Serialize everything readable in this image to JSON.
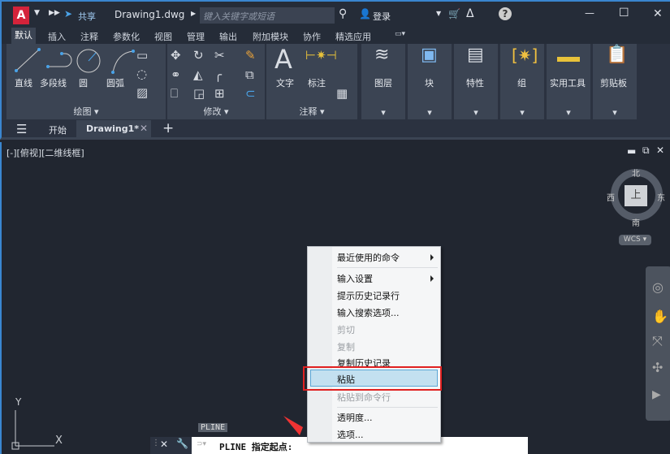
{
  "titlebar": {
    "logo": "A",
    "share": "共享",
    "filename": "Drawing1.dwg",
    "search_placeholder": "键入关键字或短语",
    "login": "登录"
  },
  "menu_tabs": [
    "默认",
    "插入",
    "注释",
    "参数化",
    "视图",
    "管理",
    "输出",
    "附加模块",
    "协作",
    "精选应用"
  ],
  "ribbon": {
    "draw": {
      "buttons": [
        "直线",
        "多段线",
        "圆",
        "圆弧"
      ],
      "label": "绘图"
    },
    "modify": {
      "label": "修改"
    },
    "annotate": {
      "buttons": [
        "文字",
        "标注"
      ],
      "label": "注释"
    },
    "panels": [
      "图层",
      "块",
      "特性",
      "组",
      "实用工具",
      "剪贴板"
    ]
  },
  "file_tabs": {
    "start": "开始",
    "drawing": "Drawing1*"
  },
  "viewport": {
    "label": "[-][俯视][二维线框]",
    "viewcube": {
      "top": "上",
      "north": "北",
      "south": "南",
      "east": "东",
      "west": "西",
      "wcs": "WCS"
    },
    "ucs_x": "X",
    "ucs_y": "Y"
  },
  "context_menu": {
    "items": [
      {
        "label": "最近使用的命令",
        "submenu": true,
        "disabled": false
      },
      {
        "label": "输入设置",
        "submenu": true,
        "disabled": false
      },
      {
        "label": "提示历史记录行",
        "disabled": false
      },
      {
        "label": "输入搜索选项...",
        "disabled": false
      },
      {
        "label": "剪切",
        "disabled": true
      },
      {
        "label": "复制",
        "disabled": true
      },
      {
        "label": "复制历史记录",
        "disabled": false
      },
      {
        "label": "粘贴",
        "disabled": false,
        "highlighted": true
      },
      {
        "label": "粘贴到命令行",
        "disabled": true
      },
      {
        "label": "透明度...",
        "disabled": false
      },
      {
        "label": "选项...",
        "disabled": false
      }
    ]
  },
  "command": {
    "tooltip": "PLINE",
    "prompt": "PLINE 指定起点:"
  },
  "colors": {
    "accent": "#3a86d0",
    "highlight_box": "#e02020",
    "menu_highlight": "#c3e0f0"
  }
}
